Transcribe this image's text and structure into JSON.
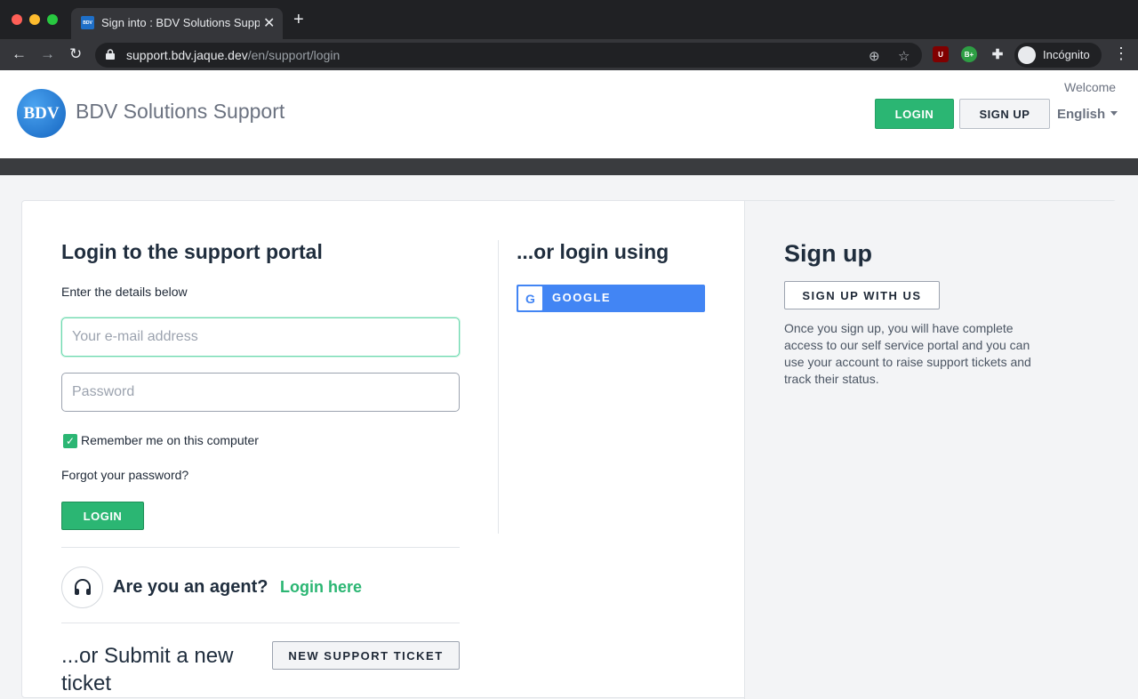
{
  "browser": {
    "tab_title": "Sign into : BDV Solutions Supp",
    "favicon_text": "BDV",
    "url_host": "support.bdv.jaque.dev",
    "url_path": "/en/support/login",
    "profile_label": "Incógnito",
    "ext_shield": "U",
    "ext_badge": "B+"
  },
  "header": {
    "logo_text": "BDV",
    "brand": "BDV Solutions Support",
    "welcome": "Welcome",
    "login_label": "LOGIN",
    "signup_label": "SIGN UP",
    "language": "English"
  },
  "login": {
    "title": "Login to the support portal",
    "subtitle": "Enter the details below",
    "email_placeholder": "Your e-mail address",
    "password_placeholder": "Password",
    "remember_label": "Remember me on this computer",
    "remember_checked": true,
    "forgot_label": "Forgot your password?",
    "button_label": "LOGIN",
    "agent_question": "Are you an agent?",
    "agent_link": "Login here",
    "submit_title": "...or Submit a new ticket",
    "new_ticket_label": "NEW SUPPORT TICKET"
  },
  "social": {
    "title": "...or login using",
    "google_label": "GOOGLE"
  },
  "signup": {
    "title": "Sign up",
    "button_label": "SIGN UP WITH US",
    "description": "Once you sign up, you will have complete access to our self service portal and you can use your account to raise support tickets and track their status."
  },
  "colors": {
    "accent_green": "#2bb673",
    "google_blue": "#4285f4",
    "heading": "#1f2d3d"
  }
}
